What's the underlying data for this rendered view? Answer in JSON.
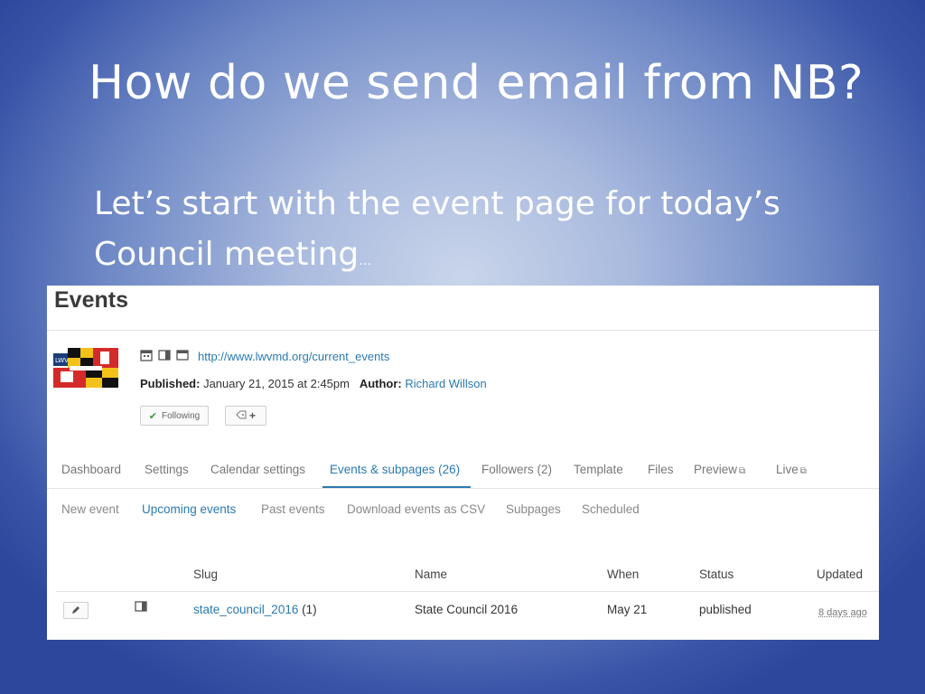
{
  "slide": {
    "title": "How do we send email from NB?",
    "subtitle": "Let’s start with the event page for today’s Council meeting",
    "subtitle_ellipsis": "…"
  },
  "panel": {
    "heading": "Events",
    "url": "http://www.lwvmd.org/current_events",
    "published_label": "Published:",
    "published_value": "January 21, 2015 at 2:45pm",
    "author_label": "Author:",
    "author_value": "Richard Willson",
    "following_label": "Following",
    "tag_add_label": "+"
  },
  "tabs": [
    {
      "label": "Dashboard",
      "active": false
    },
    {
      "label": "Settings",
      "active": false
    },
    {
      "label": "Calendar settings",
      "active": false
    },
    {
      "label": "Events & subpages (26)",
      "active": true
    },
    {
      "label": "Followers (2)",
      "active": false
    },
    {
      "label": "Template",
      "active": false
    },
    {
      "label": "Files",
      "active": false
    },
    {
      "label": "Preview",
      "active": false,
      "icon": "external-link-icon"
    },
    {
      "label": "Live",
      "active": false,
      "icon": "external-link-icon"
    }
  ],
  "subtabs": [
    {
      "label": "New event",
      "active": false
    },
    {
      "label": "Upcoming events",
      "active": true
    },
    {
      "label": "Past events",
      "active": false
    },
    {
      "label": "Download events as CSV",
      "active": false
    },
    {
      "label": "Subpages",
      "active": false
    },
    {
      "label": "Scheduled",
      "active": false
    }
  ],
  "table": {
    "columns": [
      "Slug",
      "Name",
      "When",
      "Status",
      "Updated"
    ],
    "rows": [
      {
        "slug": "state_council_2016",
        "count": "(1)",
        "name": "State Council 2016",
        "when": "May 21",
        "status": "published",
        "updated": "8 days ago"
      }
    ]
  },
  "colors": {
    "link": "#2a7ab0",
    "slide_bg_center": "#c9d5ea",
    "slide_bg_edge": "#2d479c"
  }
}
